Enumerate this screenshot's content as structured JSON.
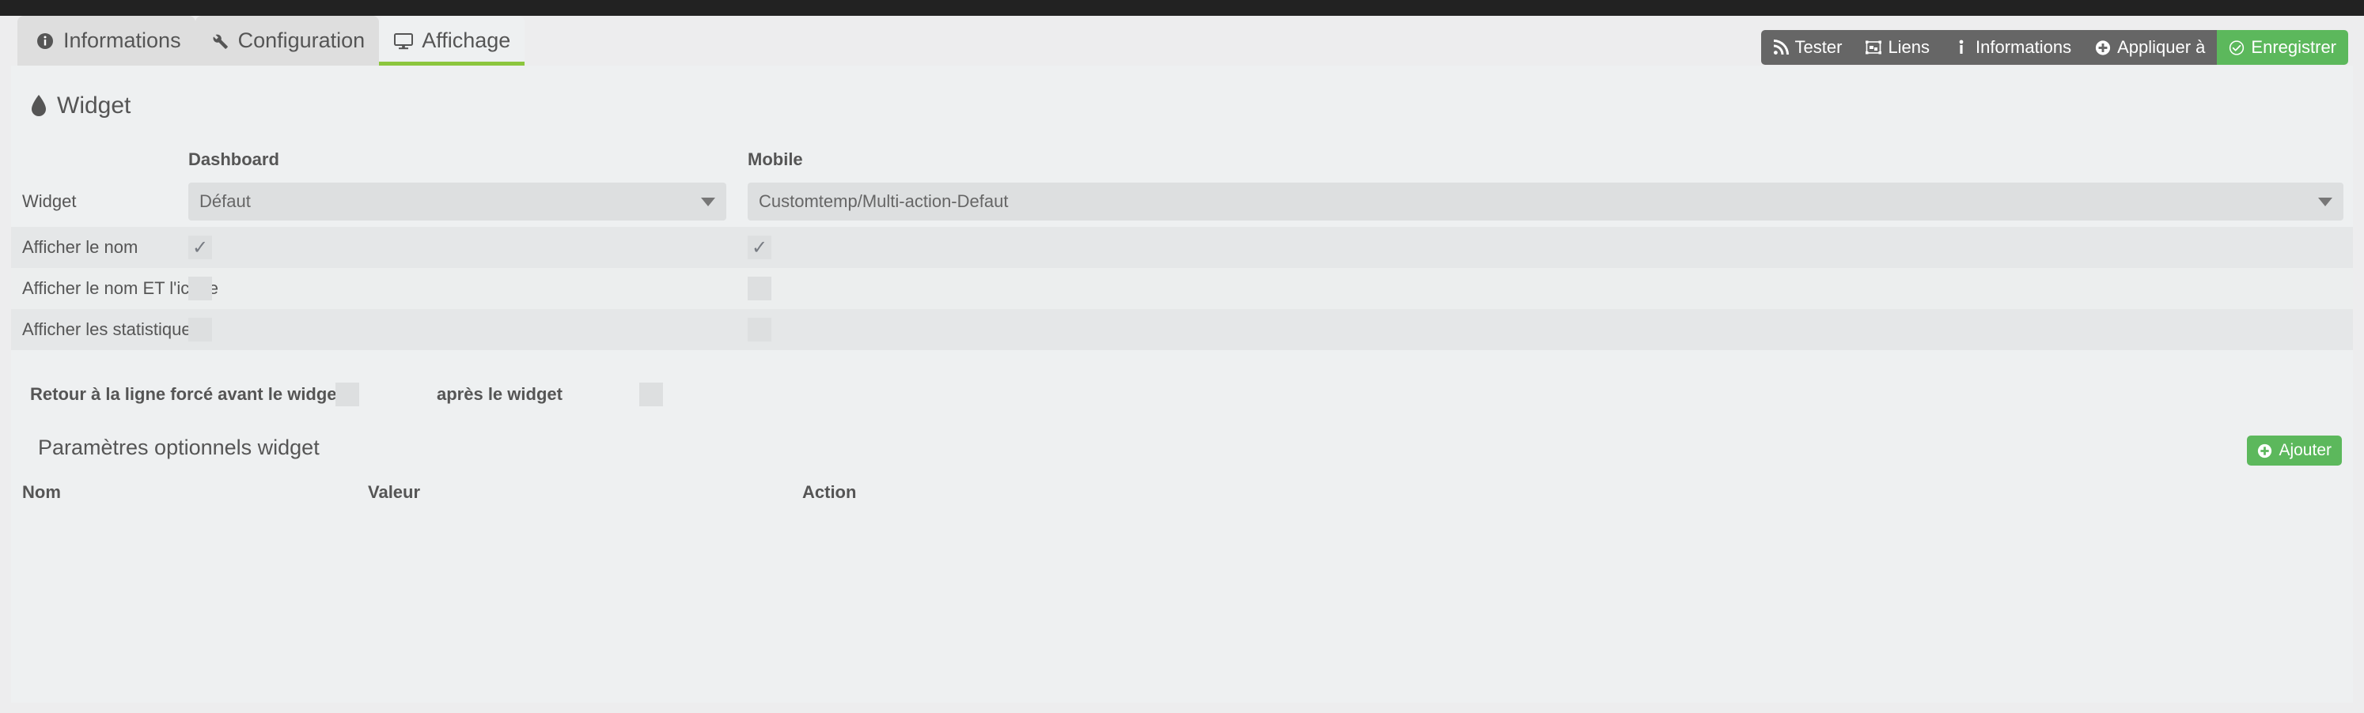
{
  "window": {
    "topbar_color": "#222222",
    "accent_green": "#5cb85c",
    "tab_underline": "#8cc63e"
  },
  "tabs": [
    {
      "label": "Informations",
      "icon": "info-circle-icon",
      "active": false
    },
    {
      "label": "Configuration",
      "icon": "wrench-icon",
      "active": false
    },
    {
      "label": "Affichage",
      "icon": "desktop-icon",
      "active": true
    }
  ],
  "actions": [
    {
      "label": "Tester",
      "icon": "rss-icon",
      "style": "dark"
    },
    {
      "label": "Liens",
      "icon": "project-diagram-icon",
      "style": "dark"
    },
    {
      "label": "Informations",
      "icon": "info-icon",
      "style": "dark"
    },
    {
      "label": "Appliquer à",
      "icon": "plus-circle-icon",
      "style": "dark"
    },
    {
      "label": "Enregistrer",
      "icon": "check-circle-icon",
      "style": "green"
    }
  ],
  "widget_section": {
    "title": "Widget",
    "icon": "tint-icon",
    "columns": {
      "dashboard": "Dashboard",
      "mobile": "Mobile"
    },
    "select_row": {
      "label": "Widget",
      "dashboard_value": "Défaut",
      "mobile_value": "Customtemp/Multi-action-Defaut"
    },
    "checkbox_rows": [
      {
        "label": "Afficher le nom",
        "dashboard_checked": true,
        "mobile_checked": true,
        "check_glyph": "✓"
      },
      {
        "label": "Afficher le nom ET l'icône",
        "dashboard_checked": false,
        "mobile_checked": false,
        "check_glyph": ""
      },
      {
        "label": "Afficher les statistiques",
        "dashboard_checked": false,
        "mobile_checked": false,
        "check_glyph": ""
      }
    ],
    "wrap_row": {
      "label_before": "Retour à la ligne forcé avant le widget",
      "label_after": "après le widget",
      "before_checked": false,
      "after_checked": false
    }
  },
  "optional_params": {
    "title": "Paramètres optionnels widget",
    "add_button": {
      "label": "Ajouter",
      "icon": "plus-circle-icon"
    },
    "table_headers": {
      "nom": "Nom",
      "valeur": "Valeur",
      "action": "Action"
    },
    "rows": []
  }
}
